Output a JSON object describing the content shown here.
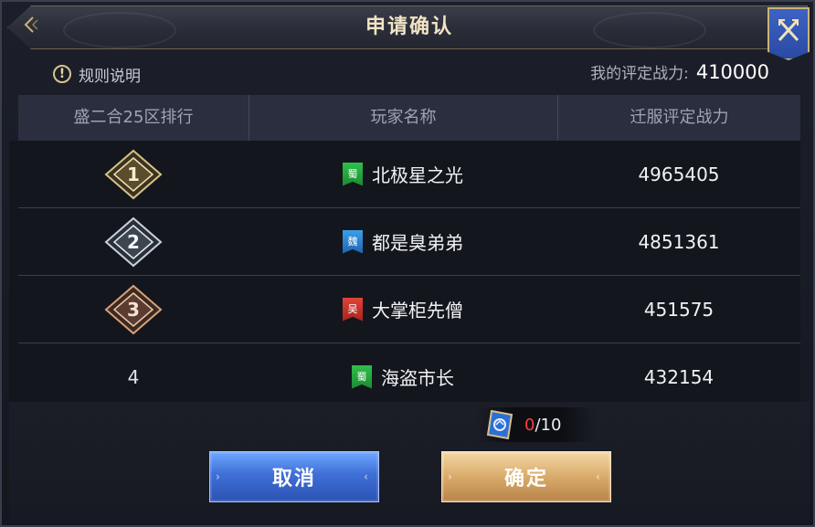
{
  "dialog": {
    "title": "申请确认",
    "back_icon": "chevron-left-icon",
    "close_icon": "crossed-swords-close-icon"
  },
  "info": {
    "rules_label": "规则说明",
    "rules_icon": "exclamation-icon",
    "power_label": "我的评定战力:",
    "power_value": "410000"
  },
  "table": {
    "columns": [
      "盛二合25区排行",
      "玩家名称",
      "迁服评定战力"
    ],
    "rows": [
      {
        "rank": "1",
        "badge": "gold",
        "faction": "蜀",
        "faction_color": "#2fbf4b",
        "name": "北极星之光",
        "power": "4965405"
      },
      {
        "rank": "2",
        "badge": "silver",
        "faction": "魏",
        "faction_color": "#3b9fe8",
        "name": "都是臭弟弟",
        "power": "4851361"
      },
      {
        "rank": "3",
        "badge": "bronze",
        "faction": "吴",
        "faction_color": "#e0443a",
        "name": "大掌柜先僧",
        "power": "451575"
      },
      {
        "rank": "4",
        "badge": "none",
        "faction": "蜀",
        "faction_color": "#2fbf4b",
        "name": "海盗市长",
        "power": "432154"
      }
    ]
  },
  "ticket": {
    "icon": "migration-ticket-icon",
    "current": "0",
    "max": "/10"
  },
  "buttons": {
    "cancel_label": "取消",
    "confirm_label": "确定"
  },
  "colors": {
    "gold_badge": "#d9c186",
    "silver_badge": "#c9d2de",
    "bronze_badge": "#d8a07a",
    "cancel_button": "#3f6fd6",
    "confirm_button": "#d9ab6a",
    "count_current": "#ff3d3d"
  }
}
